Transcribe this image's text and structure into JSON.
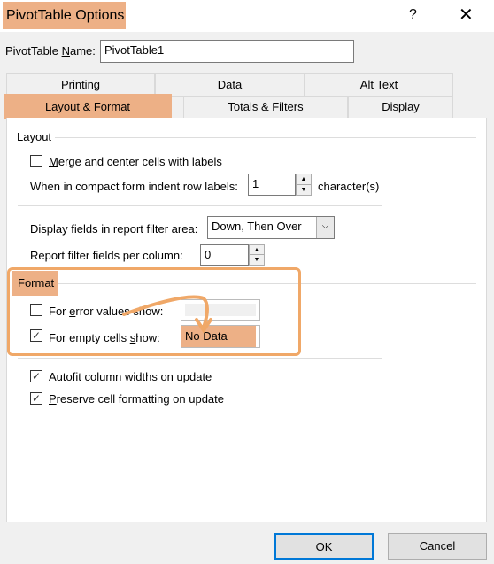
{
  "window": {
    "title": "PivotTable Options",
    "help": "?",
    "close": "✕"
  },
  "name_field": {
    "label": "PivotTable Name:",
    "value": "PivotTable1"
  },
  "tabs_row1": [
    "Printing",
    "Data",
    "Alt Text"
  ],
  "tabs_row2": [
    "Layout & Format",
    "Totals & Filters",
    "Display"
  ],
  "active_tab": "Layout & Format",
  "layout": {
    "heading": "Layout",
    "merge_label": "Merge and center cells with labels",
    "merge_checked": false,
    "indent_label": "When in compact form indent row labels:",
    "indent_value": "1",
    "indent_unit": "character(s)",
    "display_fields_label": "Display fields in report filter area:",
    "display_fields_value": "Down, Then Over",
    "filter_fields_label": "Report filter fields per column:",
    "filter_fields_value": "0"
  },
  "format": {
    "heading": "Format",
    "error_label": "For error values show:",
    "error_checked": false,
    "error_value": "",
    "empty_label": "For empty cells show:",
    "empty_checked": true,
    "empty_value": "No Data",
    "autofit_label": "Autofit column widths on update",
    "autofit_checked": true,
    "preserve_label": "Preserve cell formatting on update",
    "preserve_checked": true
  },
  "buttons": {
    "ok": "OK",
    "cancel": "Cancel"
  },
  "colors": {
    "highlight": "#edb086",
    "annotation": "#f0a868",
    "ok_border": "#0078d7"
  }
}
